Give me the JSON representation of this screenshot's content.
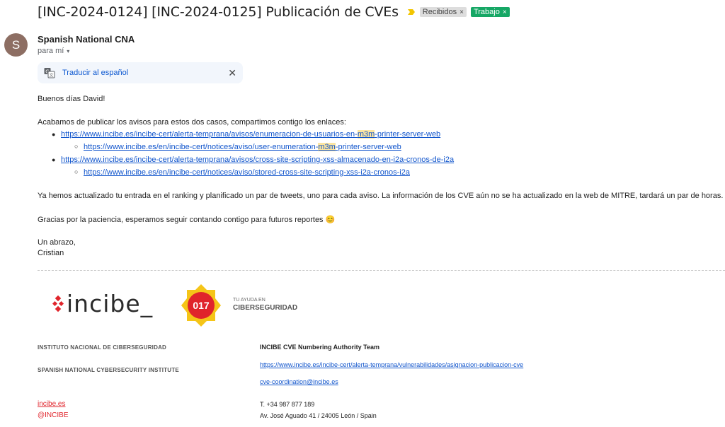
{
  "subject": {
    "title": "[INC-2024-0124] [INC-2024-0125] Publicación de CVEs",
    "labels": [
      {
        "text": "Recibidos",
        "remove": "×"
      },
      {
        "text": "Trabajo",
        "remove": "×"
      }
    ]
  },
  "sender": {
    "avatar_letter": "S",
    "name": "Spanish National CNA",
    "recipient": "para mí",
    "caret": "▾"
  },
  "translate": {
    "label": "Traducir al español",
    "close": "✕"
  },
  "message": {
    "greeting": "Buenos días David!",
    "intro": "Acabamos de publicar los avisos para estos dos casos, compartimos contigo los enlaces:",
    "links": {
      "l1_pre": "https://www.incibe.es/incibe-cert/alerta-temprana/avisos/enumeracion-de-usuarios-en-",
      "l1_hl": "m3m",
      "l1_post": "-printer-server-web",
      "l1a_pre": "https://www.incibe.es/en/incibe-cert/notices/aviso/user-enumeration-",
      "l1a_hl": "m3m",
      "l1a_post": "-printer-server-web",
      "l2": "https://www.incibe.es/incibe-cert/alerta-temprana/avisos/cross-site-scripting-xss-almacenado-en-i2a-cronos-de-i2a",
      "l2a": "https://www.incibe.es/en/incibe-cert/notices/aviso/stored-cross-site-scripting-xss-i2a-cronos-i2a"
    },
    "update": "Ya hemos actualizado tu entrada en el ranking y planificado un par de tweets, uno para cada aviso. La información de los CVE aún no se ha actualizado en la web de MITRE, tardará un par de horas.",
    "thanks": "Gracias por la paciencia, esperamos seguir contando contigo para futuros reportes",
    "emoji": "😊",
    "closing": "Un abrazo,",
    "name": "Cristian"
  },
  "signature": {
    "logo_text": "incibe_",
    "badge_number": "017",
    "tagline_top": "TU AYUDA EN",
    "tagline_bottom": "CIBERSEGURIDAD",
    "institute_es": "INSTITUTO NACIONAL DE CIBERSEGURIDAD",
    "institute_en": "SPANISH NATIONAL CYBERSECURITY INSTITUTE",
    "team": "INCIBE CVE Numbering Authority Team",
    "team_link": "https://www.incibe.es/incibe-cert/alerta-temprana/vulnerabilidades/asignacion-publicacion-cve",
    "email": "cve-coordination@incibe.es",
    "web": "incibe.es",
    "twitter": "@INCIBE",
    "phone": "T. +34 987 877 189",
    "address": "Av. José Aguado 41 / 24005 León / Spain"
  },
  "colors": {
    "brand_red": "#e0242b",
    "link_blue": "#1155cc",
    "label_green": "#16a765",
    "badge_yellow": "#f5c518",
    "highlight": "#fbe5a1"
  }
}
